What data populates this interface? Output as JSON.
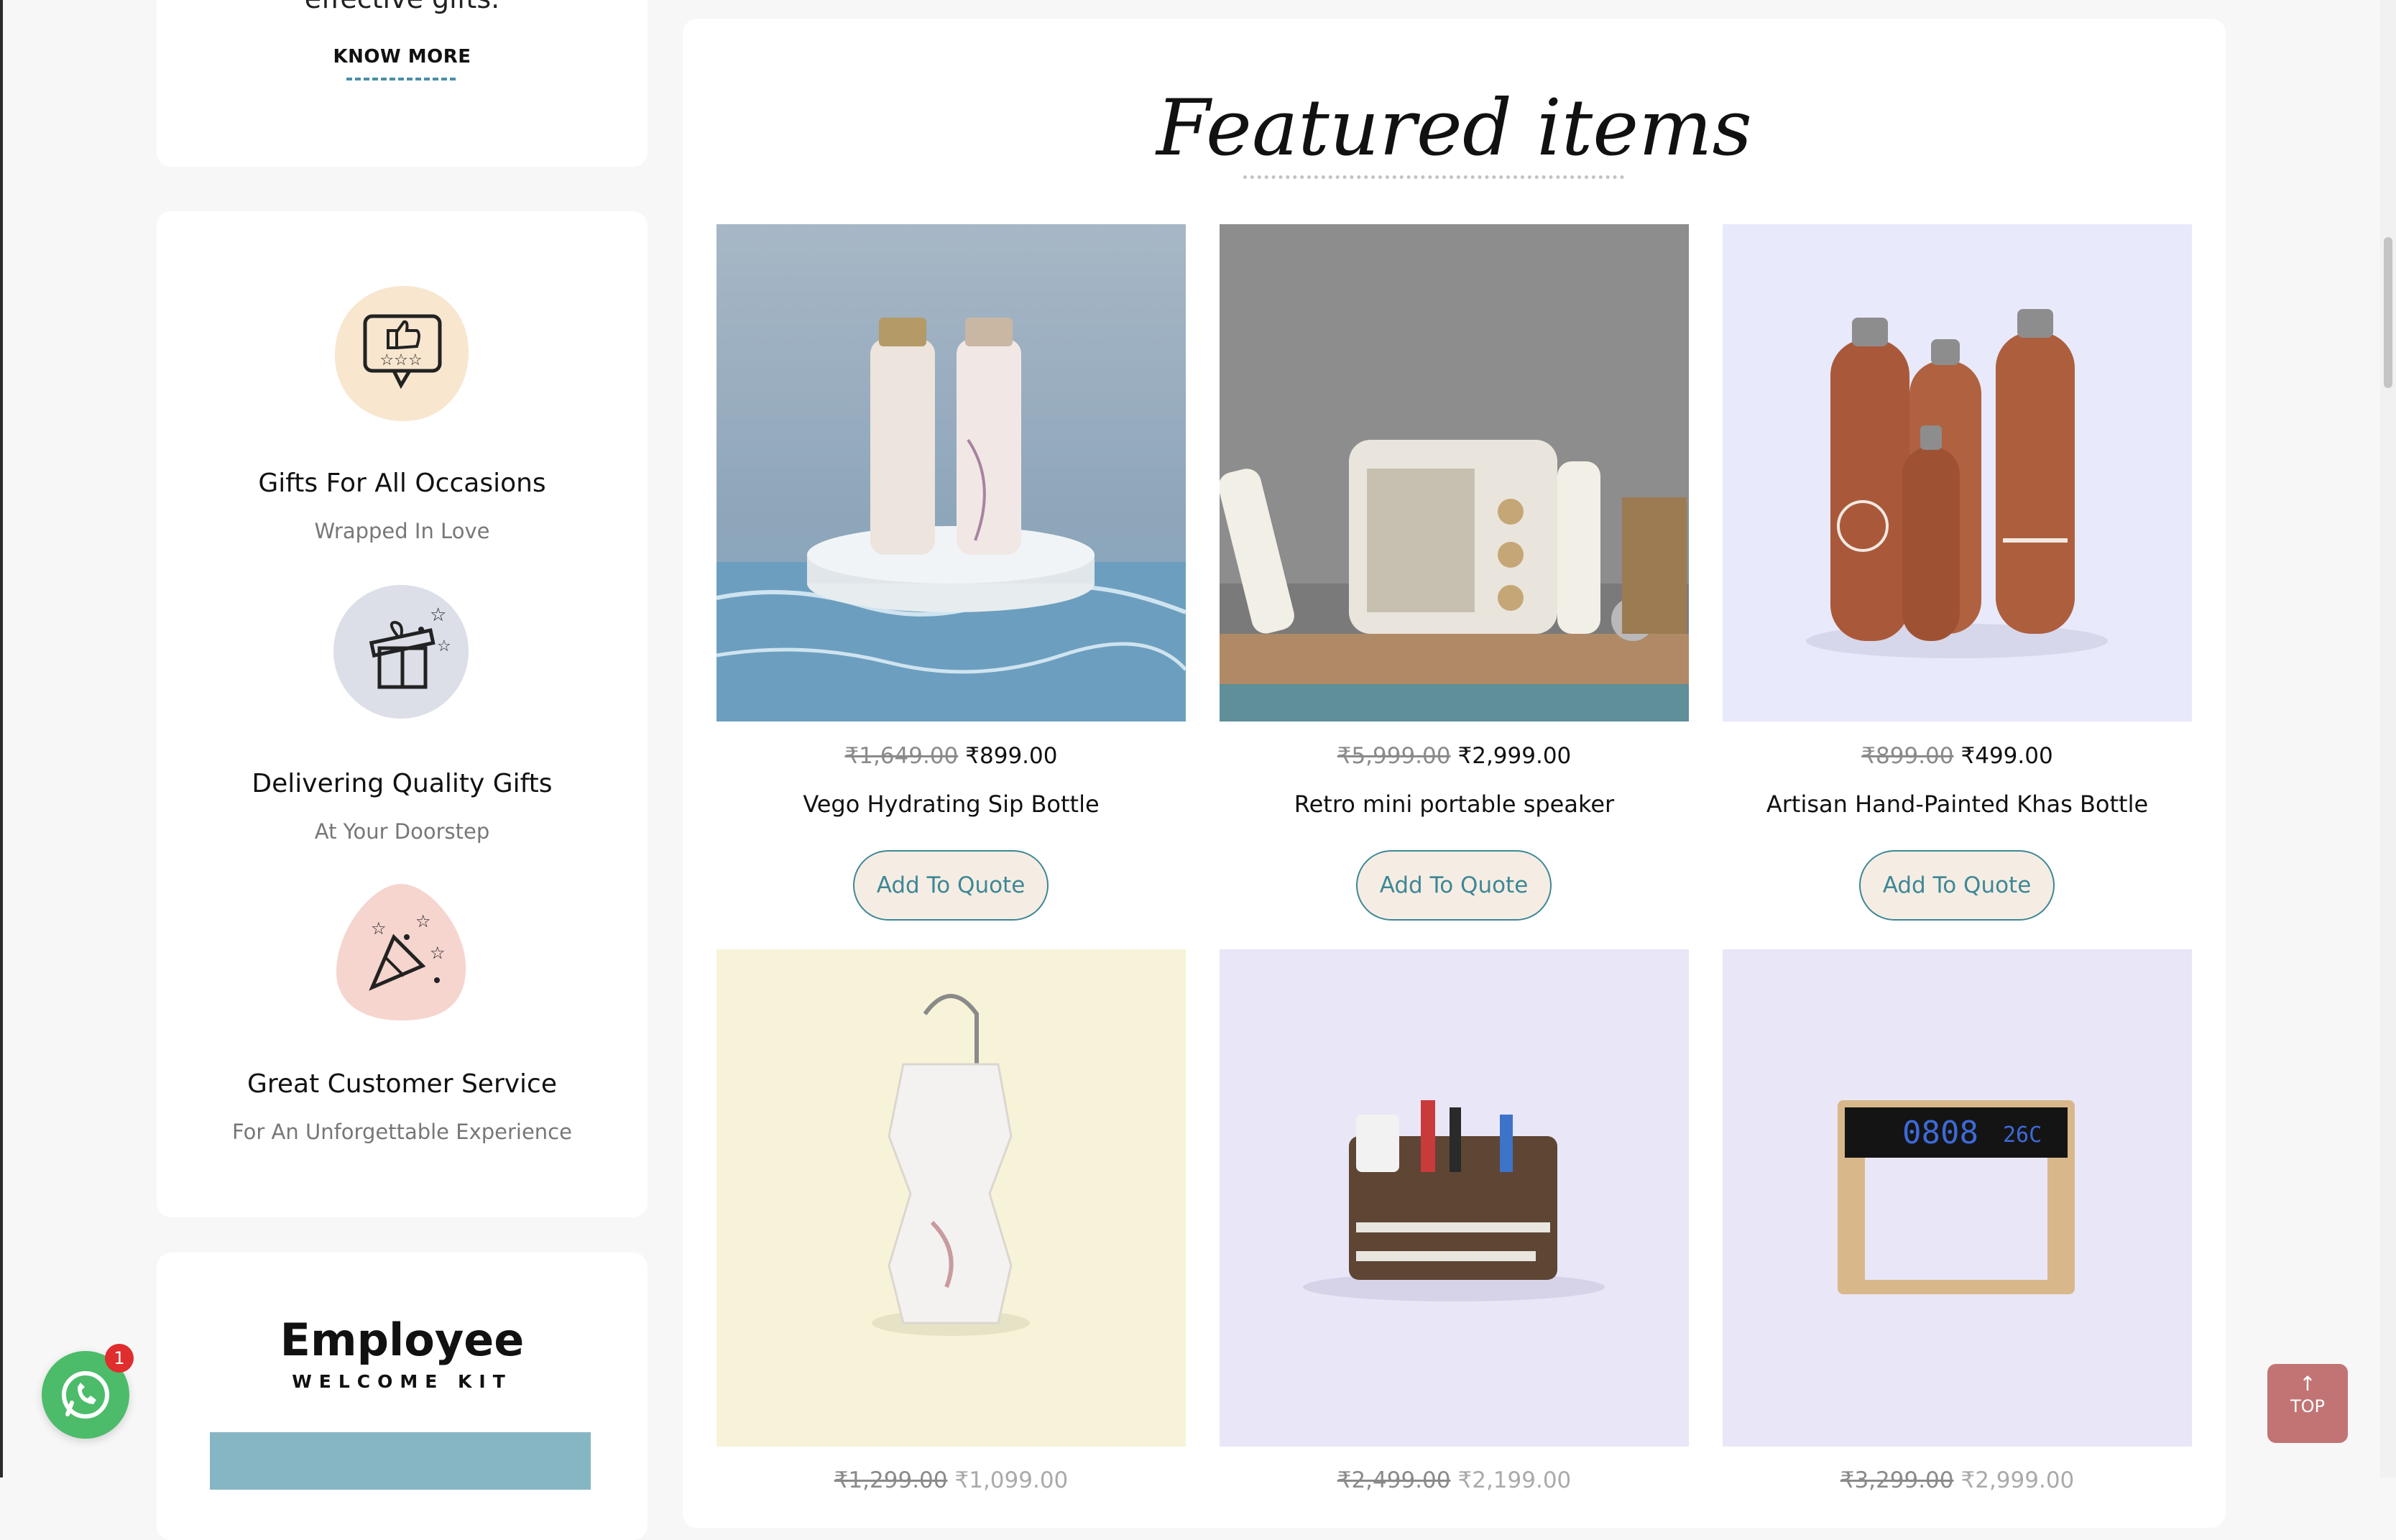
{
  "sidebar": {
    "intro_text": "effective gifts.",
    "know_more": "KNOW MORE",
    "features": [
      {
        "title": "Gifts For All Occasions",
        "subtitle": "Wrapped In Love",
        "icon": "thumbs-up-review-icon",
        "color": "#f8e6cf"
      },
      {
        "title": "Delivering Quality Gifts",
        "subtitle": "At Your Doorstep",
        "icon": "gift-box-icon",
        "color": "#dcdfe8"
      },
      {
        "title": "Great Customer Service",
        "subtitle": "For An Unforgettable Experience",
        "icon": "party-popper-icon",
        "color": "#f5d5ce"
      }
    ],
    "employee": {
      "title": "Employee",
      "subtitle": "WELCOME KIT"
    }
  },
  "featured": {
    "heading": "Featured items",
    "quote_label": "Add To Quote",
    "products": [
      {
        "name": "Vego Hydrating Sip Bottle",
        "old_price": "₹1,649.00",
        "price": "₹899.00"
      },
      {
        "name": "Retro mini portable speaker",
        "old_price": "₹5,999.00",
        "price": "₹2,999.00"
      },
      {
        "name": "Artisan Hand-Painted Khas Bottle",
        "old_price": "₹899.00",
        "price": "₹499.00"
      }
    ],
    "row2_prices": [
      {
        "old_price": "₹1,299.00",
        "price": "₹1,099.00"
      },
      {
        "old_price": "₹2,499.00",
        "price": "₹2,199.00"
      },
      {
        "old_price": "₹3,299.00",
        "price": "₹2,999.00"
      }
    ]
  },
  "floating": {
    "whatsapp_badge": "1",
    "top_label": "TOP",
    "top_arrow": "↑"
  },
  "colors": {
    "accent": "#3e8796",
    "quote_bg": "#f5ede3",
    "top_button": "#c27474",
    "whatsapp": "#4cbc6a"
  }
}
